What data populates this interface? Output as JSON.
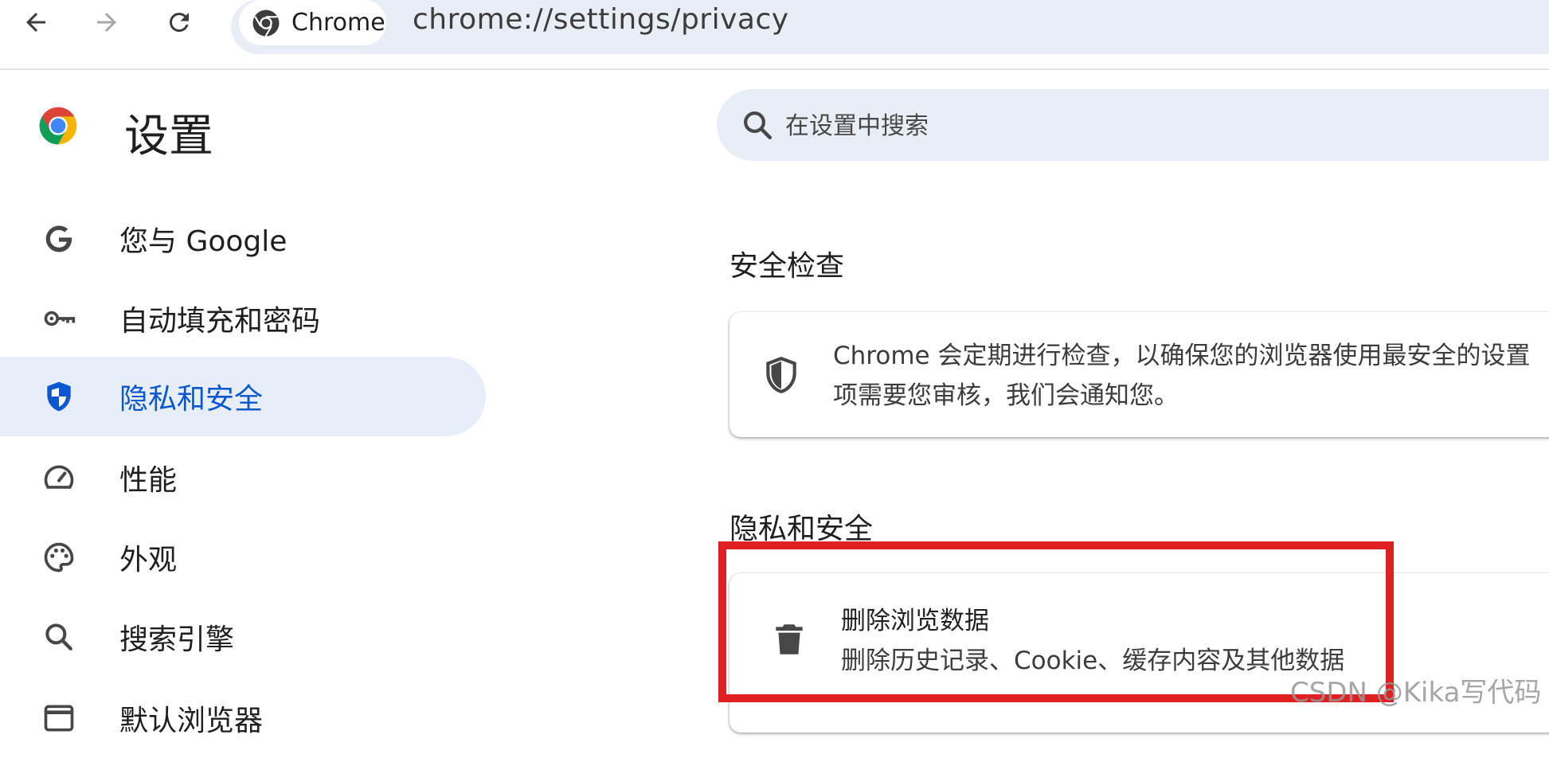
{
  "browser": {
    "chip_label": "Chrome",
    "url": "chrome://settings/privacy"
  },
  "sidebar": {
    "title": "设置",
    "items": [
      {
        "label": "您与 Google",
        "icon": "google-g-icon"
      },
      {
        "label": "自动填充和密码",
        "icon": "key-icon"
      },
      {
        "label": "隐私和安全",
        "icon": "shield-icon",
        "active": true
      },
      {
        "label": "性能",
        "icon": "speedometer-icon"
      },
      {
        "label": "外观",
        "icon": "palette-icon"
      },
      {
        "label": "搜索引擎",
        "icon": "search-icon"
      },
      {
        "label": "默认浏览器",
        "icon": "browser-window-icon"
      }
    ]
  },
  "search": {
    "placeholder": "在设置中搜索"
  },
  "safety_check": {
    "heading": "安全检查",
    "line1": "Chrome 会定期进行检查，以确保您的浏览器使用最安全的设置",
    "line2": "项需要您审核，我们会通知您。"
  },
  "privacy": {
    "heading": "隐私和安全",
    "clear_data_title": "删除浏览数据",
    "clear_data_desc": "删除历史记录、Cookie、缓存内容及其他数据"
  },
  "watermark": "CSDN @Kika写代码",
  "colors": {
    "accent": "#0b57d0",
    "active_bg": "#e8eef9",
    "highlight": "#e02020"
  }
}
